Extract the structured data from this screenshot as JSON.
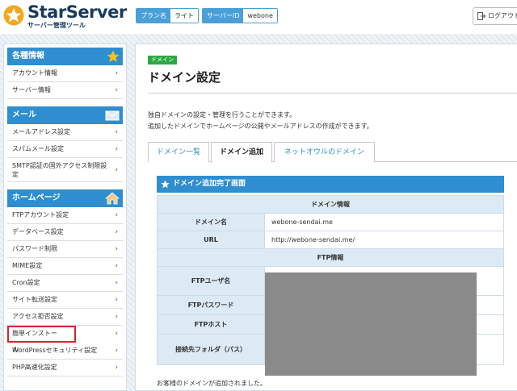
{
  "header": {
    "logo_text": "StarServer",
    "logo_sub": "サーバー管理ツール",
    "plan_label": "プラン名",
    "plan_value": "ライト",
    "server_label": "サーバーID",
    "server_value": "webone",
    "logout_label": "ログアウト"
  },
  "sidebar": {
    "sections": [
      {
        "title": "各種情報",
        "icon": "star-icon",
        "items": [
          "アカウント情報",
          "サーバー情報"
        ]
      },
      {
        "title": "メール",
        "icon": "envelope-icon",
        "items": [
          "メールアドレス設定",
          "スパムメール設定",
          "SMTP認証の国外アクセス制限設定"
        ]
      },
      {
        "title": "ホームページ",
        "icon": "home-icon",
        "items": [
          "FTPアカウント設定",
          "データベース設定",
          "パスワード制限",
          "MIME設定",
          "Cron設定",
          "サイト転送設定",
          "アクセス拒否設定",
          "簡単インストール",
          "WordPressセキュリティ設定",
          "PHP高速化設定"
        ]
      }
    ]
  },
  "main": {
    "tag": "ドメイン",
    "title": "ドメイン設定",
    "desc1": "独自ドメインの設定・管理を行うことができます。",
    "desc2": "追加したドメインでホームページの公開やメールアドレスの作成ができます。",
    "tabs": [
      "ドメイン一覧",
      "ドメイン追加",
      "ネットオウルのドメイン"
    ],
    "box_title": "ドメイン追加完了画面",
    "domain_info_caption": "ドメイン情報",
    "domain_name_label": "ドメイン名",
    "domain_name_value": "webone-sendai.me",
    "url_label": "URL",
    "url_value": "http://webone-sendai.me/",
    "ftp_info_caption": "FTP情報",
    "ftp_user_label": "FTPユーザ名",
    "ftp_password_label": "FTPパスワード",
    "ftp_host_label": "FTPホスト",
    "folder_label": "接続先フォルダ（パス）",
    "footer_text": "お客様のドメインが追加されました。"
  },
  "colors": {
    "accent": "#2e8ecf",
    "tag_green": "#2ea845",
    "highlight_red": "#d9232d"
  }
}
